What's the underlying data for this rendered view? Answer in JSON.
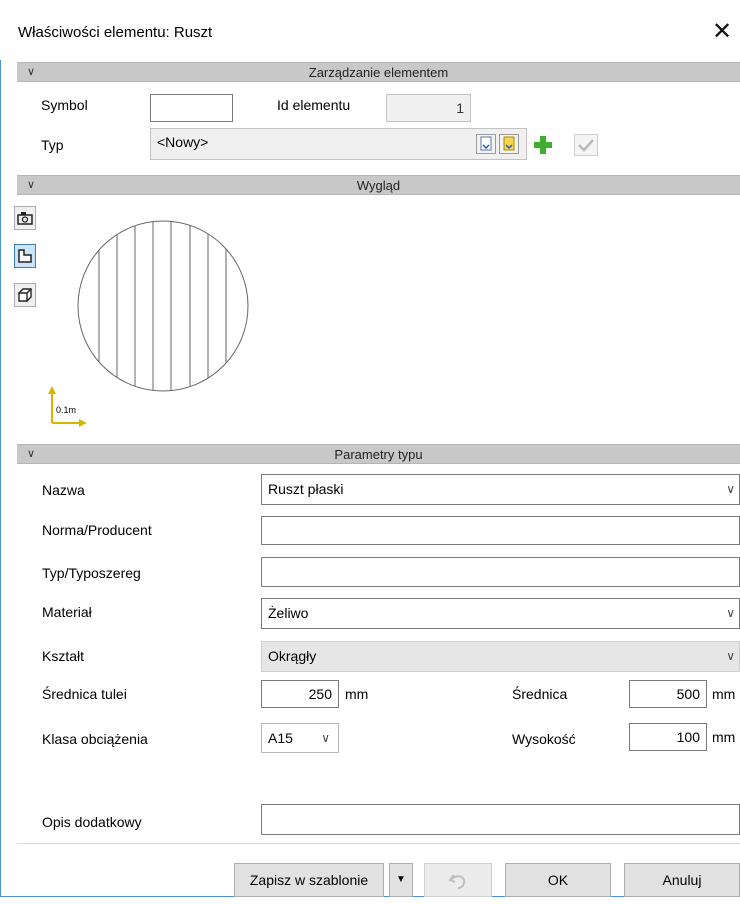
{
  "window": {
    "title": "Właściwości elementu: Ruszt",
    "close_glyph": "✕"
  },
  "sections": {
    "management": "Zarządzanie elementem",
    "appearance": "Wygląd",
    "type_params": "Parametry typu"
  },
  "management": {
    "symbol_label": "Symbol",
    "symbol_value": "",
    "id_label": "Id elementu",
    "id_value": "1",
    "type_label": "Typ",
    "type_value": "<Nowy>"
  },
  "preview": {
    "scale_label": "0.1m",
    "view_buttons": [
      "camera-icon",
      "plan-view-icon",
      "3d-box-icon"
    ],
    "active_view": "plan-view-icon"
  },
  "params": {
    "name_label": "Nazwa",
    "name_value": "Ruszt płaski",
    "norm_label": "Norma/Producent",
    "norm_value": "",
    "series_label": "Typ/Typoszereg",
    "series_value": "",
    "material_label": "Materiał",
    "material_value": "Żeliwo",
    "shape_label": "Kształt",
    "shape_value": "Okrągły",
    "sleeve_diam_label": "Średnica tulei",
    "sleeve_diam_value": "250",
    "sleeve_diam_unit": "mm",
    "diam_label": "Średnica",
    "diam_value": "500",
    "diam_unit": "mm",
    "load_class_label": "Klasa obciążenia",
    "load_class_value": "A15",
    "height_label": "Wysokość",
    "height_value": "100",
    "height_unit": "mm",
    "desc_label": "Opis dodatkowy",
    "desc_value": ""
  },
  "footer": {
    "save_template_label": "Zapisz w szablonie",
    "ok_label": "OK",
    "cancel_label": "Anuluj"
  },
  "colors": {
    "section_bar": "#c8c8c8",
    "accent_border": "#4a90d9",
    "active_view": "#cce4f7"
  }
}
